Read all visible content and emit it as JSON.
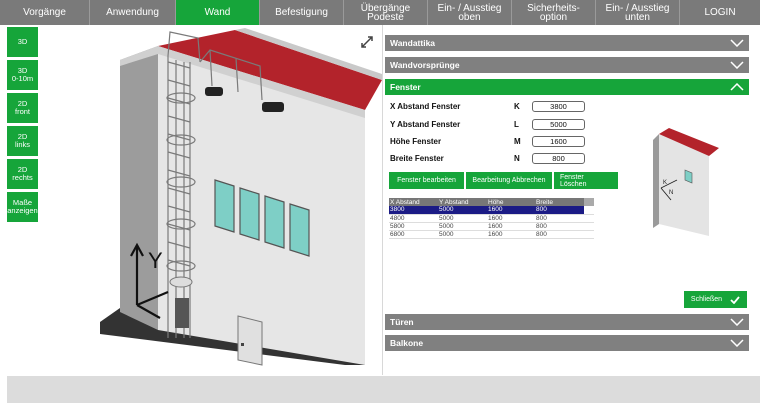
{
  "nav": {
    "items": [
      "Vorgänge",
      "Anwendung",
      "Wand",
      "Befestigung",
      "Übergänge\nPodeste",
      "Ein- / Ausstieg\noben",
      "Sicherheits-\noption",
      "Ein- / Ausstieg\nunten",
      "LOGIN"
    ],
    "active": "Wand"
  },
  "sidebar": {
    "buttons": [
      "3D",
      "3D\n0-10m",
      "2D\nfront",
      "2D\nlinks",
      "2D\nrechts",
      "Maße\nanzeigen"
    ]
  },
  "scene": {
    "axis_label": "Y",
    "roof_color": "#b3232b",
    "wall_color": "#e6e6e6",
    "window_color": "#7ecfc6"
  },
  "panel": {
    "sections": {
      "wandattika": "Wandattika",
      "wandverspruenge": "Wandvorsprünge",
      "fenster": "Fenster",
      "tueren": "Türen",
      "balkone": "Balkone"
    },
    "form": [
      {
        "label": "X Abstand Fenster",
        "key": "K",
        "value": "3800"
      },
      {
        "label": "Y Abstand Fenster",
        "key": "L",
        "value": "5000"
      },
      {
        "label": "Höhe Fenster",
        "key": "M",
        "value": "1600"
      },
      {
        "label": "Breite Fenster",
        "key": "N",
        "value": "800"
      }
    ],
    "actions": [
      "Fenster bearbeiten",
      "Bearbeitung Abbrechen",
      "Fenster Löschen"
    ],
    "table": {
      "headers": [
        "X Abstand",
        "Y Abstand",
        "Höhe",
        "Breite"
      ],
      "rows": [
        [
          "3800",
          "5000",
          "1600",
          "800"
        ],
        [
          "4800",
          "5000",
          "1600",
          "800"
        ],
        [
          "5800",
          "5000",
          "1600",
          "800"
        ],
        [
          "6800",
          "5000",
          "1600",
          "800"
        ]
      ],
      "selected_row": 0
    },
    "close_label": "Schließen",
    "accent": "#16a53a"
  }
}
